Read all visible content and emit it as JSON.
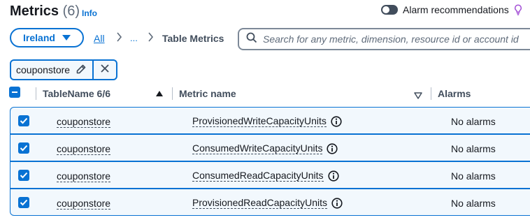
{
  "header": {
    "title": "Metrics",
    "count": "(6)",
    "info_label": "Info",
    "alarm_toggle_label": "Alarm recommendations"
  },
  "toolbar": {
    "region_label": "Ireland",
    "breadcrumb": {
      "all": "All",
      "separator": ">",
      "ellipsis": "...",
      "current": "Table Metrics"
    },
    "search_placeholder": "Search for any metric, dimension, resource id or account id"
  },
  "filter": {
    "token": "couponstore"
  },
  "table": {
    "columns": {
      "table_name": "TableName 6/6",
      "metric_name": "Metric name",
      "alarms": "Alarms"
    },
    "rows": [
      {
        "table": "couponstore",
        "metric": "ProvisionedWriteCapacityUnits",
        "alarms": "No alarms"
      },
      {
        "table": "couponstore",
        "metric": "ConsumedWriteCapacityUnits",
        "alarms": "No alarms"
      },
      {
        "table": "couponstore",
        "metric": "ConsumedReadCapacityUnits",
        "alarms": "No alarms"
      },
      {
        "table": "couponstore",
        "metric": "ProvisionedReadCapacityUnits",
        "alarms": "No alarms"
      }
    ]
  },
  "icons": {
    "region_dropdown": "caret-down-icon",
    "breadcrumb_separator": "chevron-right-icon",
    "search": "search-icon",
    "edit": "pencil-icon",
    "remove": "close-icon",
    "info": "info-circle-icon",
    "alarm_recommendations": "lightbulb-icon",
    "sort_asc": "sort-ascending-icon",
    "sort_desc": "sort-descending-icon"
  },
  "colors": {
    "accent": "#0972d3",
    "row_selected_bg": "#f2f8fd",
    "text": "#16191f",
    "muted": "#5f6b7a",
    "toggle_off": "#414d5c",
    "bulb": "#a452d6"
  }
}
